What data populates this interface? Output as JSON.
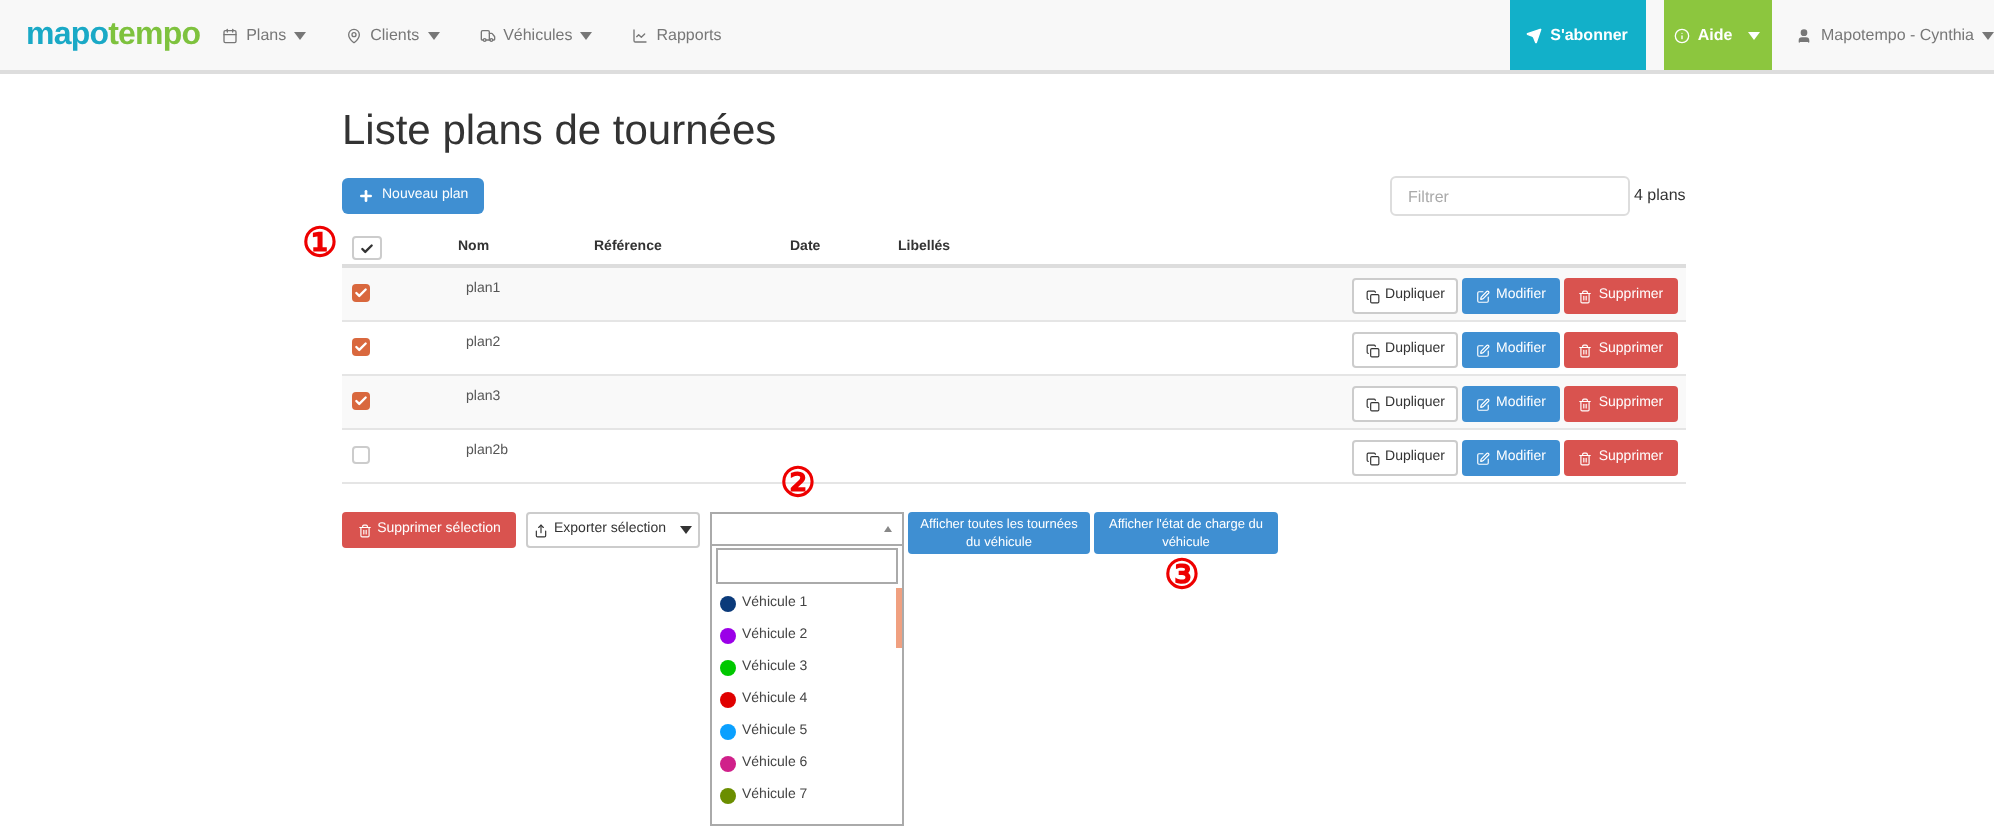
{
  "navbar": {
    "logo_left": "mapo",
    "logo_right": "tempo",
    "menus": [
      {
        "label": "Plans",
        "caret": true
      },
      {
        "label": "Clients",
        "caret": true
      },
      {
        "label": "Véhicules",
        "caret": true
      },
      {
        "label": "Rapports",
        "caret": false
      }
    ],
    "subscribe": "S'abonner",
    "help": "Aide",
    "user": "Mapotempo - Cynthia"
  },
  "title": "Liste plans de tournées",
  "new_button": "Nouveau plan",
  "filter": {
    "placeholder": "Filtrer"
  },
  "count": "4 plans",
  "table": {
    "columns": [
      "Nom",
      "Référence",
      "Date",
      "Libellés"
    ],
    "select_all": {
      "checked": true
    },
    "rows": [
      {
        "name": "plan1",
        "checked": true,
        "actions": {
          "duplicate": "Dupliquer",
          "edit": "Modifier",
          "delete": "Supprimer"
        }
      },
      {
        "name": "plan2",
        "checked": true,
        "actions": {
          "duplicate": "Dupliquer",
          "edit": "Modifier",
          "delete": "Supprimer"
        }
      },
      {
        "name": "plan3",
        "checked": true,
        "actions": {
          "duplicate": "Dupliquer",
          "edit": "Modifier",
          "delete": "Supprimer"
        }
      },
      {
        "name": "plan2b",
        "checked": false,
        "actions": {
          "duplicate": "Dupliquer",
          "edit": "Modifier",
          "delete": "Supprimer"
        }
      }
    ]
  },
  "bottom": {
    "delete_selection": "Supprimer sélection",
    "export_selection": "Exporter sélection",
    "show_all": "Afficher toutes les tournées du véhicule",
    "show_load": "Afficher l'état de charge du véhicule"
  },
  "vehicle_dropdown": {
    "open": true,
    "items": [
      {
        "label": "Véhicule 1",
        "color": "#0b3a7a"
      },
      {
        "label": "Véhicule 2",
        "color": "#9b00e8"
      },
      {
        "label": "Véhicule 3",
        "color": "#00c800"
      },
      {
        "label": "Véhicule 4",
        "color": "#e00000"
      },
      {
        "label": "Véhicule 5",
        "color": "#0aa0ff"
      },
      {
        "label": "Véhicule 6",
        "color": "#d0208a"
      },
      {
        "label": "Véhicule 7",
        "color": "#6b8e00"
      }
    ]
  },
  "annotations": [
    "①",
    "②",
    "③"
  ]
}
